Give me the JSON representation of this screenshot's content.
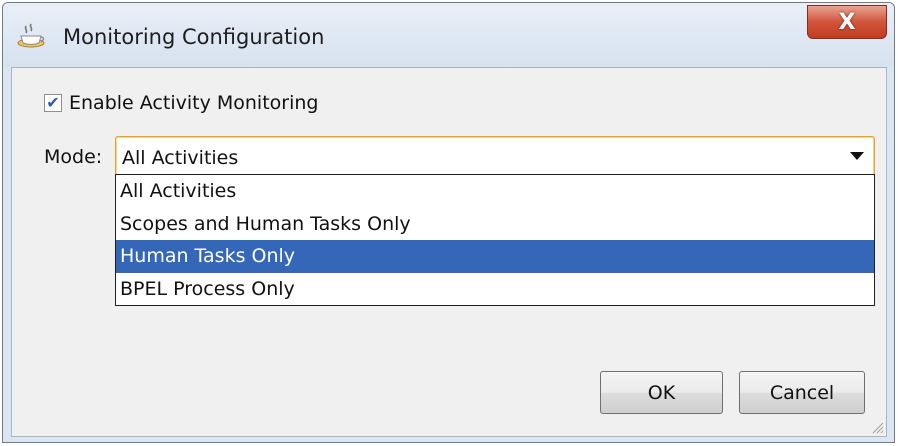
{
  "window": {
    "title": "Monitoring Configuration",
    "title_icon": "coffee-cup-icon",
    "close_glyph": "X"
  },
  "monitoring": {
    "checkbox_label": "Enable Activity Monitoring",
    "checkbox_checked": true,
    "check_glyph": "✔",
    "mode_label": "Mode:",
    "mode_value": "All Activities",
    "mode_options": [
      "All Activities",
      "Scopes and Human Tasks Only",
      "Human Tasks Only",
      "BPEL Process Only"
    ],
    "highlighted_option_index": 2
  },
  "buttons": {
    "ok": "OK",
    "cancel": "Cancel"
  },
  "colors": {
    "highlight": "#3567b8",
    "focus_border": "#e2a232",
    "close_button": "#c23b22"
  }
}
